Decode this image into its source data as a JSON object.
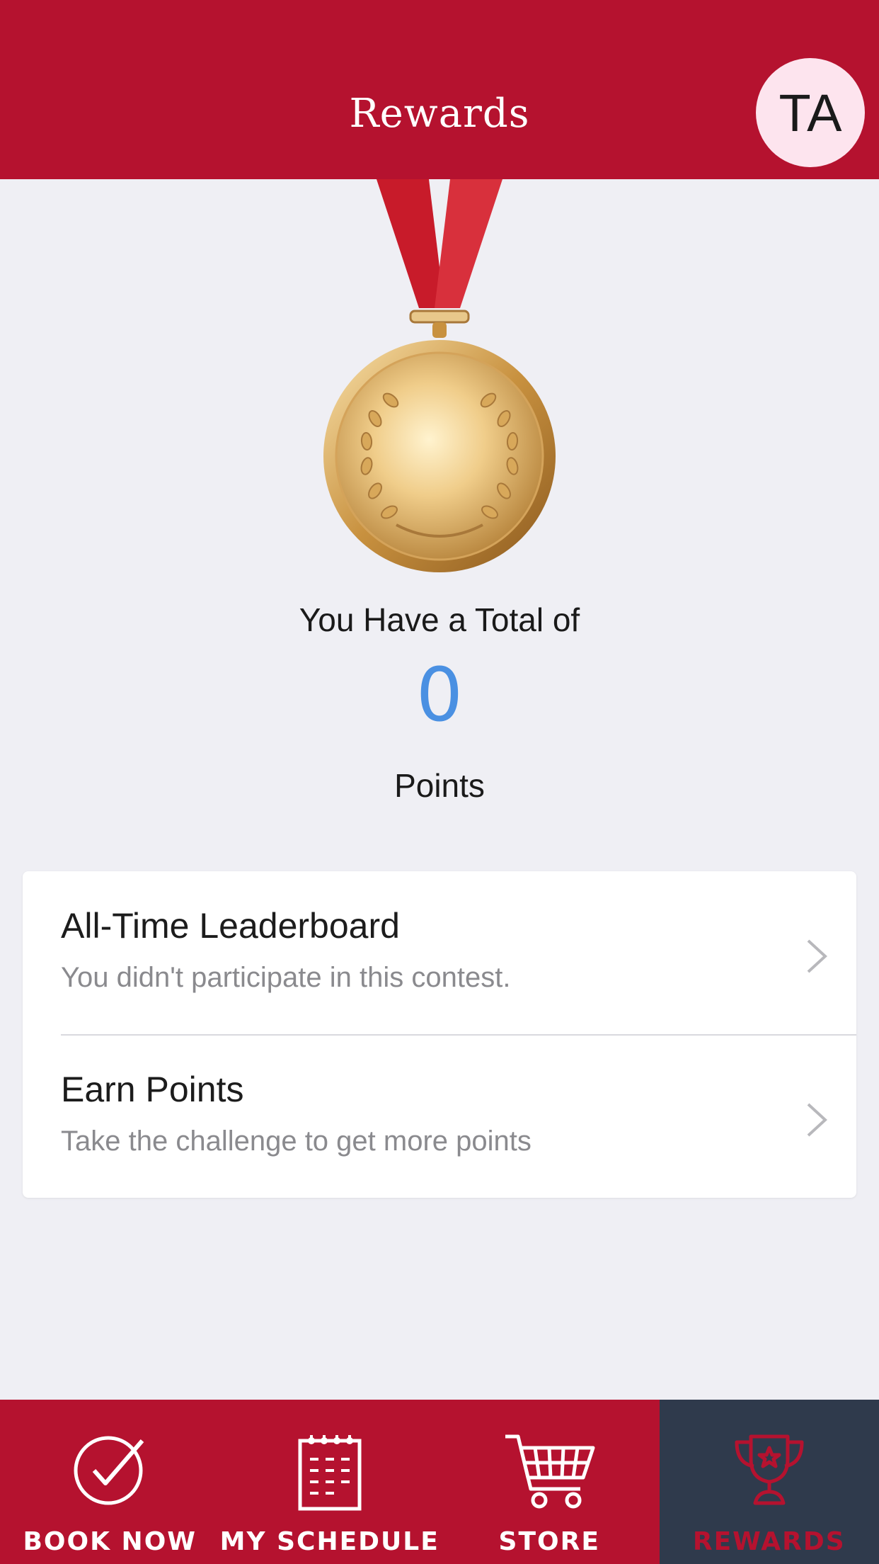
{
  "header": {
    "title": "Rewards",
    "avatar_initials": "TA"
  },
  "summary": {
    "label": "You Have a Total of",
    "points": "0",
    "unit": "Points"
  },
  "list": [
    {
      "title": "All-Time Leaderboard",
      "subtitle": "You didn't participate in this contest."
    },
    {
      "title": "Earn Points",
      "subtitle": "Take the challenge to get more points"
    }
  ],
  "tabs": [
    {
      "label": "BOOK NOW",
      "icon": "check-circle-icon"
    },
    {
      "label": "MY SCHEDULE",
      "icon": "calendar-icon"
    },
    {
      "label": "STORE",
      "icon": "cart-icon"
    },
    {
      "label": "REWARDS",
      "icon": "trophy-icon",
      "active": true
    }
  ],
  "colors": {
    "brand": "#b5122f",
    "active_tab": "#2f3a4c",
    "points": "#4a90e2"
  }
}
